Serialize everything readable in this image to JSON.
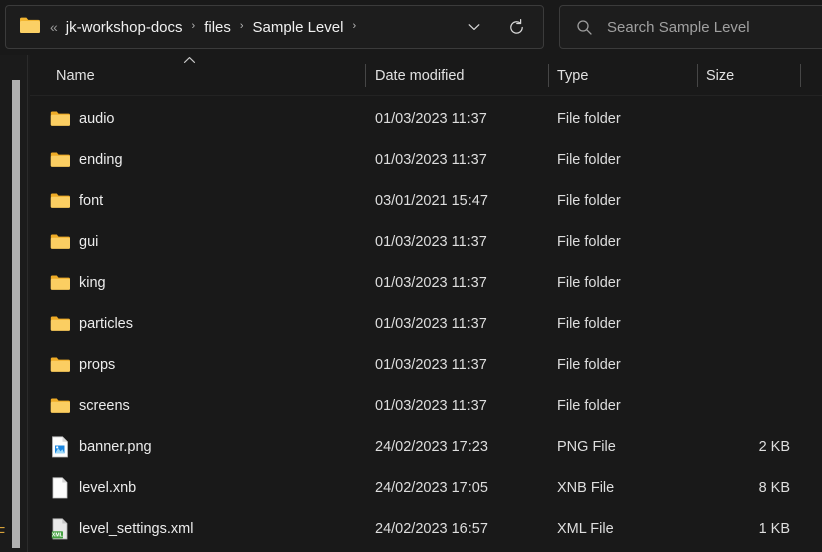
{
  "window": {
    "background_color": "#191919",
    "accent_folder_color": "#f6c košt"
  },
  "address_bar": {
    "folder_icon": "folder-icon",
    "overflow_indicator": "«",
    "separator": "›",
    "crumbs": [
      {
        "label": "jk-workshop-docs"
      },
      {
        "label": "files"
      },
      {
        "label": "Sample Level"
      }
    ],
    "dropdown_icon": "chevron-down-icon",
    "refresh_icon": "refresh-icon"
  },
  "search": {
    "icon": "search-icon",
    "placeholder": "Search Sample Level",
    "value": ""
  },
  "columns": [
    {
      "key": "name",
      "label": "Name",
      "sorted": "asc",
      "sort_icon": "chevron-up-icon"
    },
    {
      "key": "date",
      "label": "Date modified",
      "sorted": null
    },
    {
      "key": "type",
      "label": "Type",
      "sorted": null
    },
    {
      "key": "size",
      "label": "Size",
      "sorted": null
    }
  ],
  "left_pane": {
    "clipped_glyph": "F",
    "scrollbar": "vertical-scrollbar"
  },
  "files": [
    {
      "icon": "folder-icon",
      "name": "audio",
      "date": "01/03/2023 11:37",
      "type": "File folder",
      "size": ""
    },
    {
      "icon": "folder-icon",
      "name": "ending",
      "date": "01/03/2023 11:37",
      "type": "File folder",
      "size": ""
    },
    {
      "icon": "folder-icon",
      "name": "font",
      "date": "03/01/2021 15:47",
      "type": "File folder",
      "size": ""
    },
    {
      "icon": "folder-icon",
      "name": "gui",
      "date": "01/03/2023 11:37",
      "type": "File folder",
      "size": ""
    },
    {
      "icon": "folder-icon",
      "name": "king",
      "date": "01/03/2023 11:37",
      "type": "File folder",
      "size": ""
    },
    {
      "icon": "folder-icon",
      "name": "particles",
      "date": "01/03/2023 11:37",
      "type": "File folder",
      "size": ""
    },
    {
      "icon": "folder-icon",
      "name": "props",
      "date": "01/03/2023 11:37",
      "type": "File folder",
      "size": ""
    },
    {
      "icon": "folder-icon",
      "name": "screens",
      "date": "01/03/2023 11:37",
      "type": "File folder",
      "size": ""
    },
    {
      "icon": "png-file-icon",
      "name": "banner.png",
      "date": "24/02/2023 17:23",
      "type": "PNG File",
      "size": "2 KB"
    },
    {
      "icon": "blank-file-icon",
      "name": "level.xnb",
      "date": "24/02/2023 17:05",
      "type": "XNB File",
      "size": "8 KB"
    },
    {
      "icon": "xml-file-icon",
      "name": "level_settings.xml",
      "date": "24/02/2023 16:57",
      "type": "XML File",
      "size": "1 KB"
    }
  ]
}
